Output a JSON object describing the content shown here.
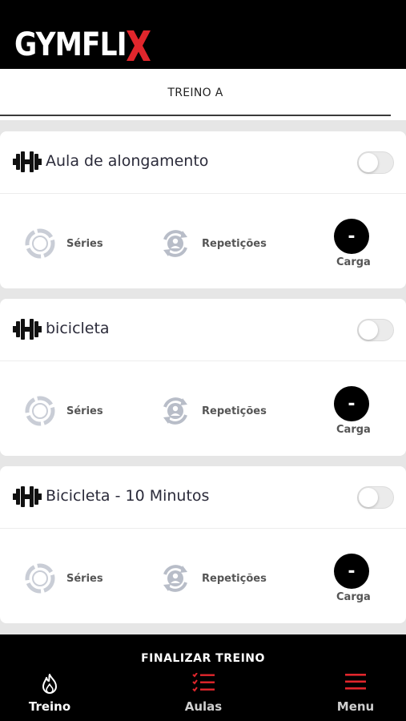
{
  "header": {
    "logo_text": "GYMFLI",
    "logo_accent_color": "#e1262c"
  },
  "tabs": [
    {
      "label": "TREINO A",
      "active": true
    }
  ],
  "exercises": [
    {
      "title": "Aula de alongamento",
      "toggle_on": false,
      "series_label": "Séries",
      "reps_label": "Repetições",
      "carga_value": "-",
      "carga_label": "Carga"
    },
    {
      "title": "bicicleta",
      "toggle_on": false,
      "series_label": "Séries",
      "reps_label": "Repetições",
      "carga_value": "-",
      "carga_label": "Carga"
    },
    {
      "title": "Bicicleta - 10 Minutos",
      "toggle_on": false,
      "series_label": "Séries",
      "reps_label": "Repetições",
      "carga_value": "-",
      "carga_label": "Carga"
    }
  ],
  "finalizar": {
    "label": "FINALIZAR TREINO"
  },
  "bottom_nav": {
    "items": [
      {
        "label": "Treino",
        "icon": "flame-icon",
        "active": true
      },
      {
        "label": "Aulas",
        "icon": "checklist-icon",
        "active": false
      },
      {
        "label": "Menu",
        "icon": "hamburger-menu-icon",
        "active": false
      }
    ],
    "active_color": "#ffffff",
    "inactive_color": "#cfcfcf",
    "icon_accent_color": "#e1262c"
  }
}
